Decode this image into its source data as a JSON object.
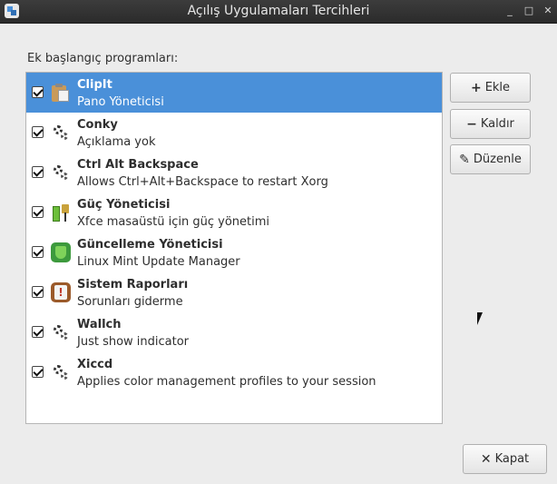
{
  "window": {
    "title": "Açılış Uygulamaları Tercihleri",
    "controls": {
      "minimize": "_",
      "maximize": "□",
      "close": "✕"
    }
  },
  "section_label": "Ek başlangıç programları:",
  "programs": [
    {
      "name": "ClipIt",
      "description": "Pano Yöneticisi",
      "checked": true,
      "selected": true,
      "icon": "clipboard-icon"
    },
    {
      "name": "Conky",
      "description": "Açıklama yok",
      "checked": true,
      "selected": false,
      "icon": "gear-icon"
    },
    {
      "name": "Ctrl Alt Backspace",
      "description": "Allows Ctrl+Alt+Backspace to restart Xorg",
      "checked": true,
      "selected": false,
      "icon": "gear-icon"
    },
    {
      "name": "Güç Yöneticisi",
      "description": "Xfce masaüstü için güç yönetimi",
      "checked": true,
      "selected": false,
      "icon": "power-manager-icon"
    },
    {
      "name": "Güncelleme Yöneticisi",
      "description": "Linux Mint Update Manager",
      "checked": true,
      "selected": false,
      "icon": "shield-icon"
    },
    {
      "name": "Sistem Raporları",
      "description": "Sorunları giderme",
      "checked": true,
      "selected": false,
      "icon": "report-icon"
    },
    {
      "name": "Wallch",
      "description": "Just show indicator",
      "checked": true,
      "selected": false,
      "icon": "gear-icon"
    },
    {
      "name": "Xiccd",
      "description": "Applies color management profiles to your session",
      "checked": true,
      "selected": false,
      "icon": "gear-icon"
    }
  ],
  "buttons": {
    "add": {
      "label": "Ekle",
      "icon": "+"
    },
    "remove": {
      "label": "Kaldır",
      "icon": "−"
    },
    "edit": {
      "label": "Düzenle",
      "icon": "✎"
    },
    "close": {
      "label": "Kapat",
      "icon": "✕"
    }
  },
  "colors": {
    "selection": "#4a90d9",
    "titlebar": "#2f2f2f"
  }
}
